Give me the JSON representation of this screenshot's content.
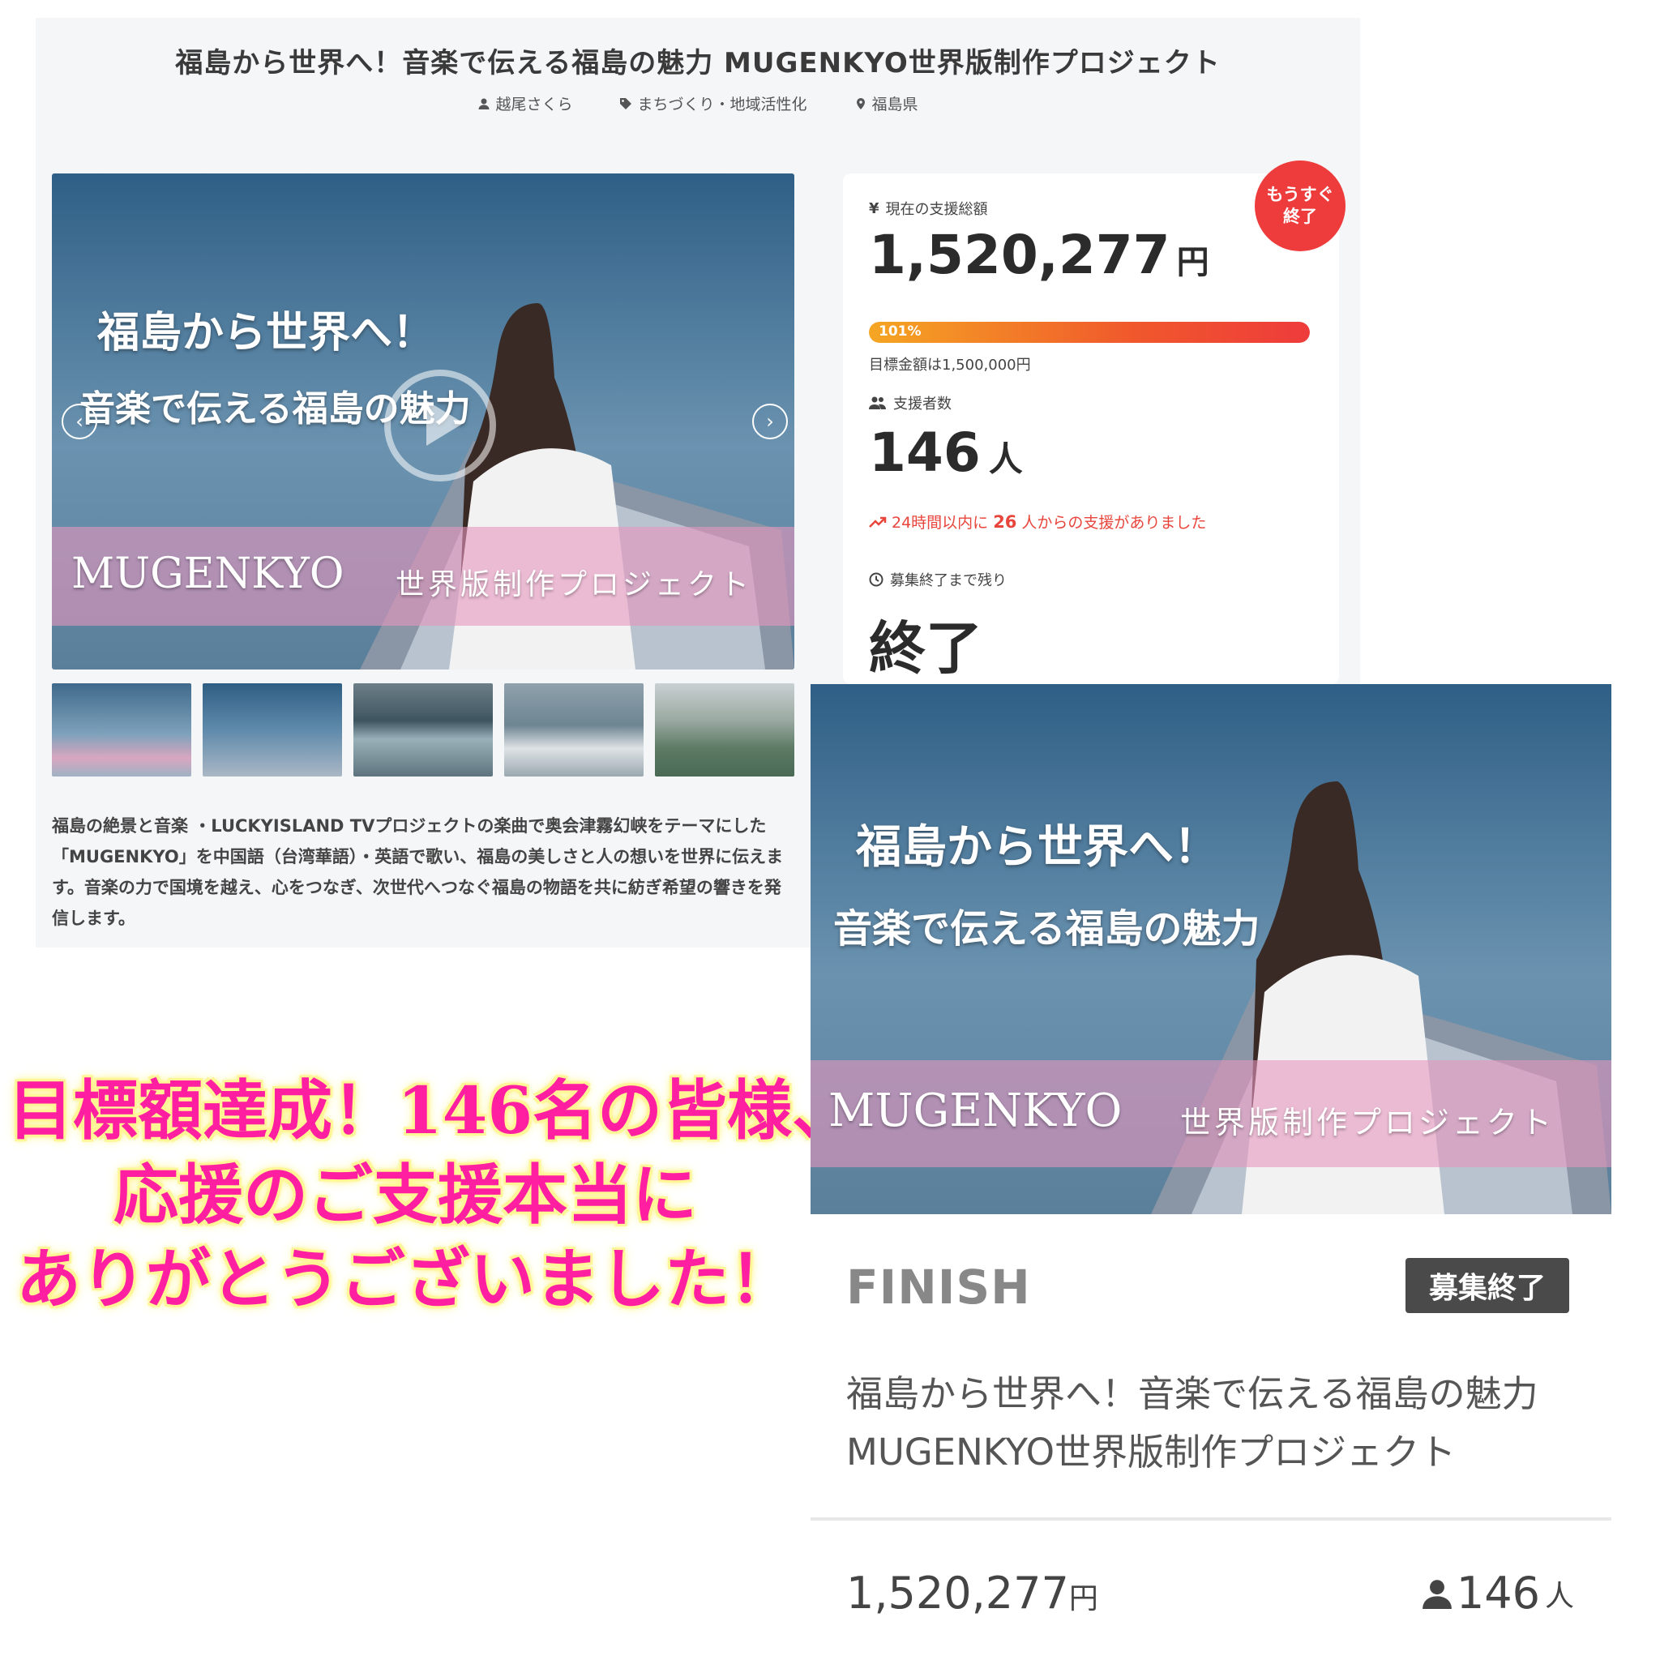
{
  "project": {
    "title": "福島から世界へ！音楽で伝える福島の魅力 MUGENKYO世界版制作プロジェクト",
    "author": "越尾さくら",
    "category": "まちづくり・地域活性化",
    "location": "福島県",
    "description": "福島の絶景と音楽 ・LUCKYISLAND TVプロジェクトの楽曲で奥会津霧幻峡をテーマにした「MUGENKYO」を中国語（台湾華語）・英語で歌い、福島の美しさと人の想いを世界に伝えます。音楽の力で国境を越え、心をつなぎ、次世代へつなぐ福島の物語を共に紡ぎ希望の響きを発信します。"
  },
  "hero": {
    "line1": "福島から世界へ！",
    "line2": "音楽で伝える福島の魅力",
    "band_latin": "MUGENKYO",
    "band_jp": "世界版制作プロジェクト",
    "prev_icon": "chevron-left-icon",
    "next_icon": "chevron-right-icon"
  },
  "stats": {
    "amount_label": "現在の支援総額",
    "amount": "1,520,277",
    "amount_unit": "円",
    "progress_percent": 101,
    "progress_label": "101%",
    "goal_text": "目標金額は1,500,000円",
    "supporters_label": "支援者数",
    "supporters": "146",
    "supporters_unit": "人",
    "trend_pre": "24時間以内に",
    "trend_num": "26",
    "trend_post": "人からの支援がありました",
    "remaining_label": "募集終了まで残り",
    "remaining_value": "終了",
    "badge_line1": "もうすぐ",
    "badge_line2": "終了",
    "accent_color": "#ee3b3b"
  },
  "finish_card": {
    "status": "FINISH",
    "badge": "募集終了",
    "title_line1": "福島から世界へ！音楽で伝える福島の魅力",
    "title_line2": "MUGENKYO世界版制作プロジェクト",
    "amount": "1,520,277",
    "amount_unit": "円",
    "supporters": "146",
    "supporters_unit": "人"
  },
  "thanks": {
    "line1": "目標額達成！146名の皆様、",
    "line2": "応援のご支援本当に",
    "line3": "ありがとうございました！",
    "color": "#ff1fa0"
  }
}
